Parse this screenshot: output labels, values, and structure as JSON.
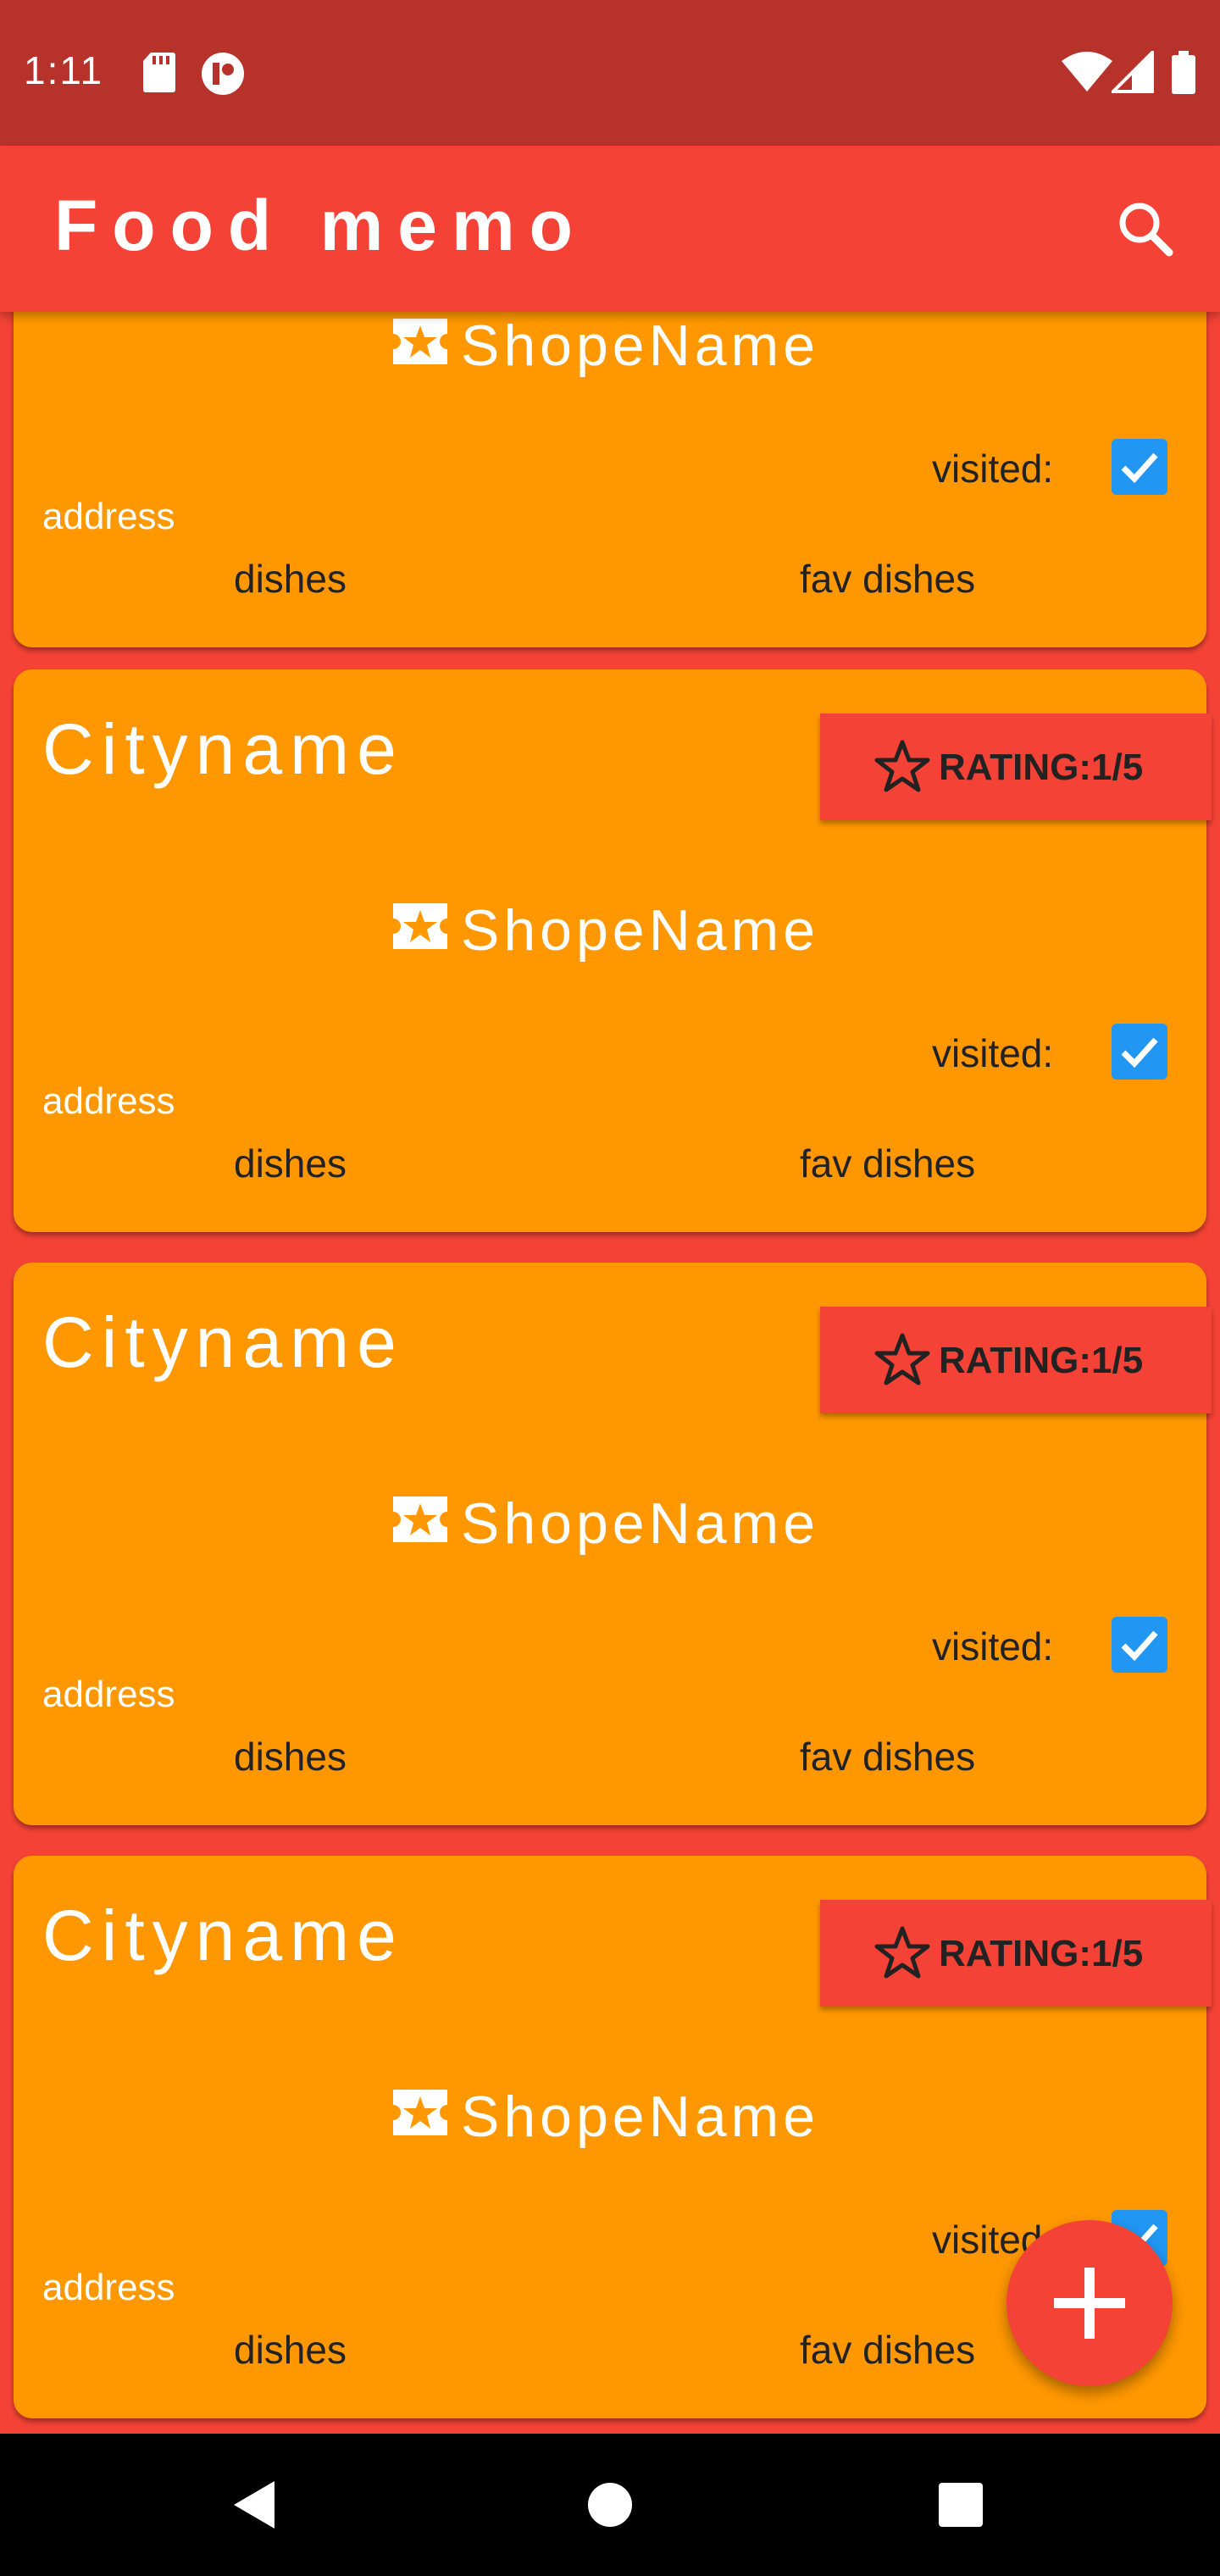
{
  "status_bar": {
    "time": "1:11",
    "icons": [
      "sd-card-icon",
      "app-notification-icon",
      "wifi-icon",
      "cellular-signal-icon",
      "battery-icon"
    ]
  },
  "app_bar": {
    "title": "Food memo",
    "search_icon": "search-icon"
  },
  "cards": [
    {
      "city": "",
      "rating_label": "",
      "shop_name": "ShopeName",
      "visited_label": "visited:",
      "visited_checked": true,
      "address": "address",
      "dishes": "dishes",
      "fav_dishes": "fav dishes"
    },
    {
      "city": "Cityname",
      "rating_label": "RATING:1/5",
      "shop_name": "ShopeName",
      "visited_label": "visited:",
      "visited_checked": true,
      "address": "address",
      "dishes": "dishes",
      "fav_dishes": "fav dishes"
    },
    {
      "city": "Cityname",
      "rating_label": "RATING:1/5",
      "shop_name": "ShopeName",
      "visited_label": "visited:",
      "visited_checked": true,
      "address": "address",
      "dishes": "dishes",
      "fav_dishes": "fav dishes"
    },
    {
      "city": "Cityname",
      "rating_label": "RATING:1/5",
      "shop_name": "ShopeName",
      "visited_label": "visited:",
      "visited_checked": true,
      "address": "address",
      "dishes": "dishes",
      "fav_dishes": "fav dishes"
    }
  ],
  "fab": {
    "icon": "plus-icon"
  },
  "nav_bar": {
    "icons": [
      "back-icon",
      "home-icon",
      "recents-icon"
    ]
  },
  "colors": {
    "status_bar": "#b8322c",
    "primary": "#f44336",
    "card": "#ff9800",
    "checkbox": "#2196f3"
  }
}
